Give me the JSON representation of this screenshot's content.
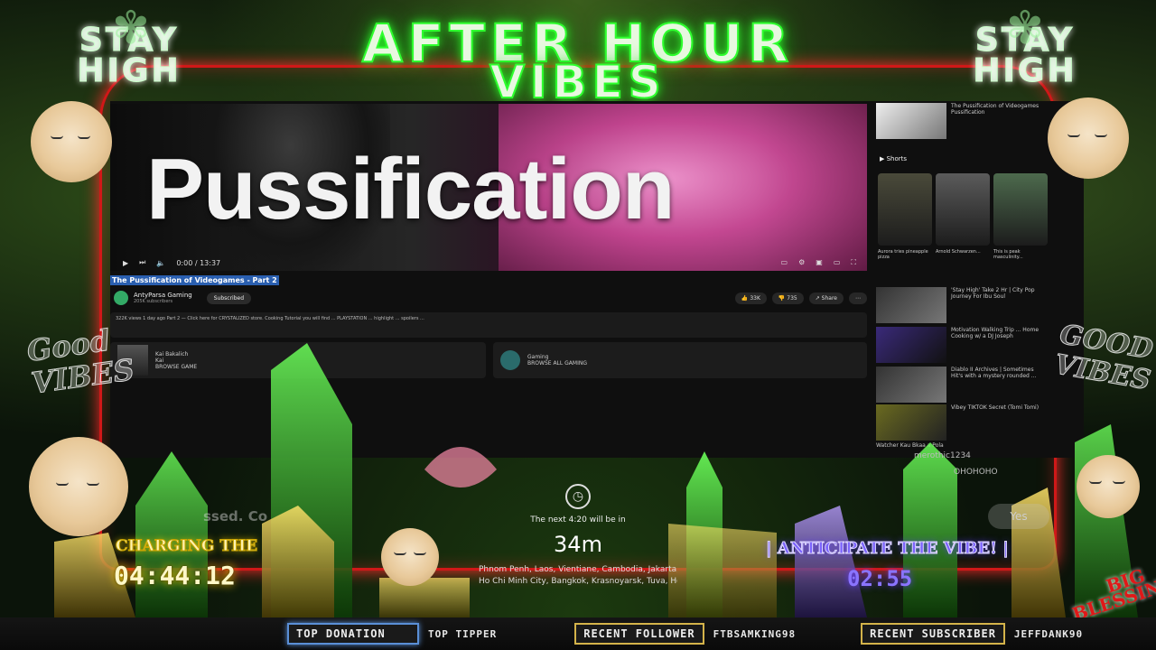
{
  "overlay": {
    "headline_line1": "AFTER HOUR",
    "headline_line2": "VIBES",
    "stay_left": "STAY HIGH",
    "stay_right": "STAY HIGH",
    "good_vibes_left": "Good VIBES",
    "good_vibes_right": "GOOD VIBES",
    "big_blessings": "BIG BLESSINGS"
  },
  "video": {
    "big_title": "Pussification",
    "time": "0:00 / 13:37",
    "title": "The Pussification of Videogames - Part 2",
    "channel": "AntyParsa Gaming",
    "subscribers": "205K subscribers",
    "subscribe_label": "Subscribed",
    "likes": "33K",
    "dislikes": "735",
    "share_label": "Share",
    "description": "322K views  1 day ago  Part 2 — Click here for CRYSTALIZED store. Cooking Tutorial you will find ... PLAYSTATION ... highlight ... spoilers ...",
    "card1_title": "Kai Bakalich",
    "card1_sub": "Kai",
    "card1_action": "BROWSE GAME",
    "card2_title": "Gaming",
    "card2_action": "BROWSE ALL GAMING"
  },
  "sidebar": {
    "top_item_title": "The Pussification of Videogames",
    "top_item_channel": "Pussification",
    "shorts_label": "Shorts",
    "short1": "Aurora tries pineapple pizza",
    "short2": "Arnold Schwarzen...",
    "short3": "This is peak masculinity...",
    "item1": "'Stay High' Take 2 Hr | City Pop Journey For Ibu Soul",
    "item2": "Motivation Walking Trip ... Home Cooking w/ a DJ Joseph",
    "item3": "Diablo II Archives | Sometimes Hit's with a mystery rounded ...",
    "item4": "Vibey TIKTOK Secret (Tomi Tomi)",
    "item5": "Watcher Kau Bkaa a Pola"
  },
  "widgets": {
    "charging_label": "CHARGING THE",
    "charging_timer": "04:44:12",
    "next_text": "The next 4:20 will be in",
    "countdown": "34m",
    "cities_line1": "Phnom Penh, Laos, Vientiane, Cambodia, Jakarta,",
    "cities_line2": "Ho Chi Minh City, Bangkok, Krasnoyarsk, Tuva, Hovd",
    "anticipate_label": "| ANTICIPATE THE VIBE! |",
    "anticipate_timer": "02:55",
    "yes_label": "Yes",
    "chat_user": "merothic1234",
    "chat_msg": "OHOHOHO",
    "faded_text": "ssed. Co"
  },
  "ticker": {
    "top_donation_label": "TOP DONATION",
    "top_tipper_label": "TOP TIPPER",
    "recent_follower_label": "RECENT FOLLOWER",
    "recent_follower_value": "FTBSAMKING98",
    "recent_subscriber_label": "RECENT SUBSCRIBER",
    "recent_subscriber_value": "JEFFDANK90"
  },
  "colors": {
    "neon_green": "#2eff2e",
    "frame_red": "#d01818",
    "gold": "#ffd400",
    "purple": "#7b63ff"
  }
}
